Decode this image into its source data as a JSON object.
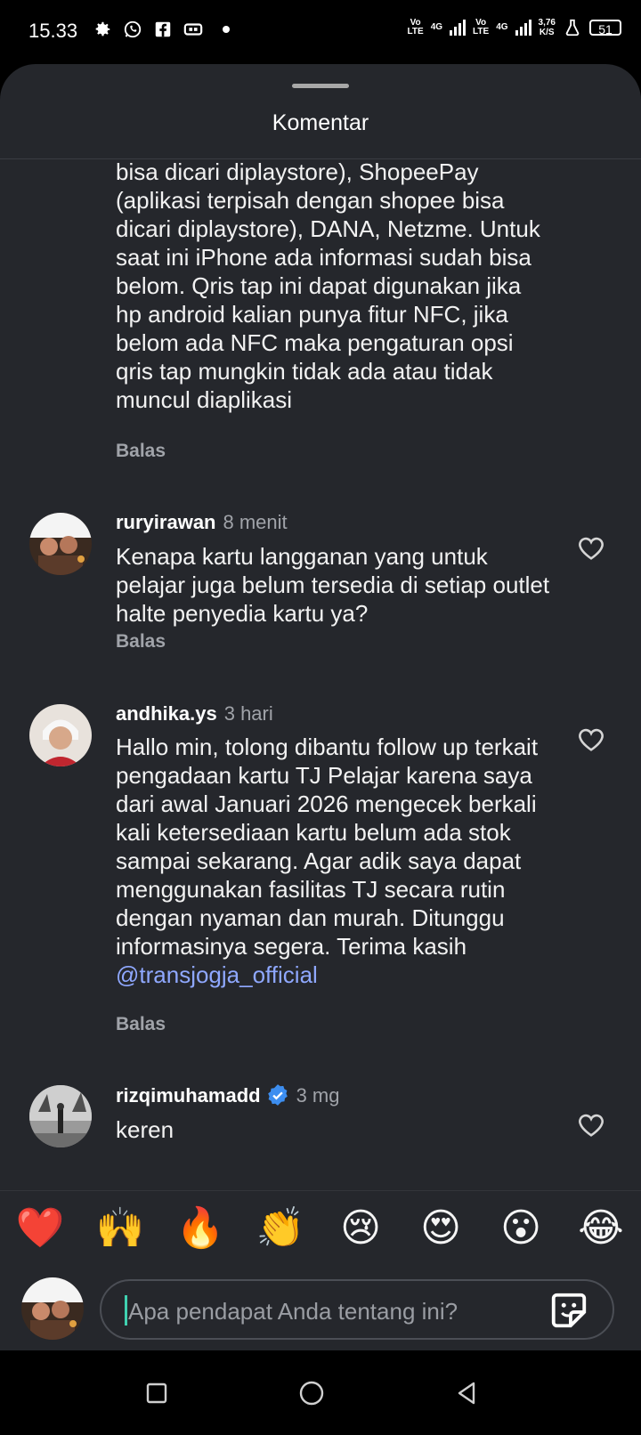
{
  "status_bar": {
    "time": "15.33",
    "net1_tag": "Vo\nLTE",
    "net1_gen": "4G",
    "net2_tag": "Vo\nLTE",
    "net2_gen": "4G",
    "speed_value": "3,76",
    "speed_unit": "K/S",
    "battery": "51"
  },
  "sheet": {
    "title": "Komentar"
  },
  "comments": [
    {
      "text": "bisa dicari diplaystore), ShopeePay (aplikasi terpisah dengan shopee bisa dicari diplaystore), DANA, Netzme. Untuk saat ini iPhone ada informasi sudah bisa belom. Qris tap ini dapat digunakan jika hp android kalian punya fitur NFC, jika belom ada NFC maka pengaturan opsi qris tap mungkin tidak ada atau tidak muncul diaplikasi",
      "reply": "Balas"
    },
    {
      "username": "ruryirawan",
      "time": "8 menit",
      "text": "Kenapa kartu langganan yang untuk pelajar juga belum tersedia di setiap outlet halte penyedia kartu ya?",
      "reply": "Balas"
    },
    {
      "username": "andhika.ys",
      "time": "3 hari",
      "text": "Hallo min, tolong dibantu follow up terkait pengadaan kartu TJ Pelajar karena saya dari awal Januari 2026 mengecek berkali kali ketersediaan kartu belum ada stok sampai sekarang. Agar adik saya dapat menggunakan fasilitas TJ secara rutin dengan nyaman dan murah. Ditunggu informasinya segera. Terima kasih",
      "mention": "@transjogja_official",
      "reply": "Balas"
    },
    {
      "username": "rizqimuhamadd",
      "time": "3 mg",
      "text": "keren"
    }
  ],
  "emoji_reactions": [
    "❤️",
    "🙌",
    "🔥",
    "👏",
    "😢",
    "😍",
    "😮",
    "😂"
  ],
  "composer": {
    "placeholder": "Apa pendapat Anda tentang ini?"
  }
}
